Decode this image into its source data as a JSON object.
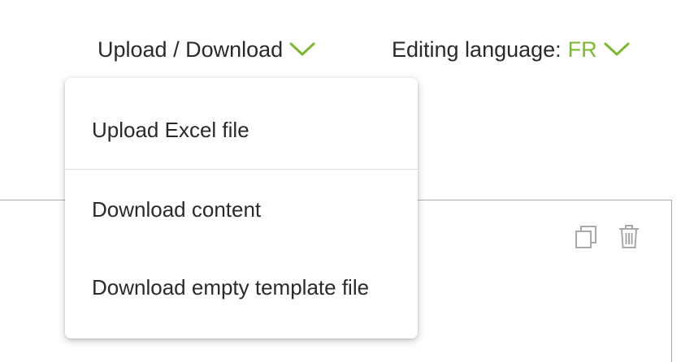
{
  "toolbar": {
    "upload_download_label": "Upload / Download",
    "editing_language_label": "Editing language:",
    "editing_language_value": "FR"
  },
  "dropdown": {
    "items": [
      {
        "label": "Upload Excel file"
      },
      {
        "label": "Download content"
      },
      {
        "label": "Download empty template file"
      }
    ]
  },
  "panel": {
    "icons": [
      "copy-icon",
      "trash-icon"
    ]
  },
  "colors": {
    "accent": "#7ab92d",
    "text": "#2a2a2a",
    "icon": "#a8a8a8",
    "panel_border": "#b3a9ac",
    "divider": "#dcdcdc"
  }
}
